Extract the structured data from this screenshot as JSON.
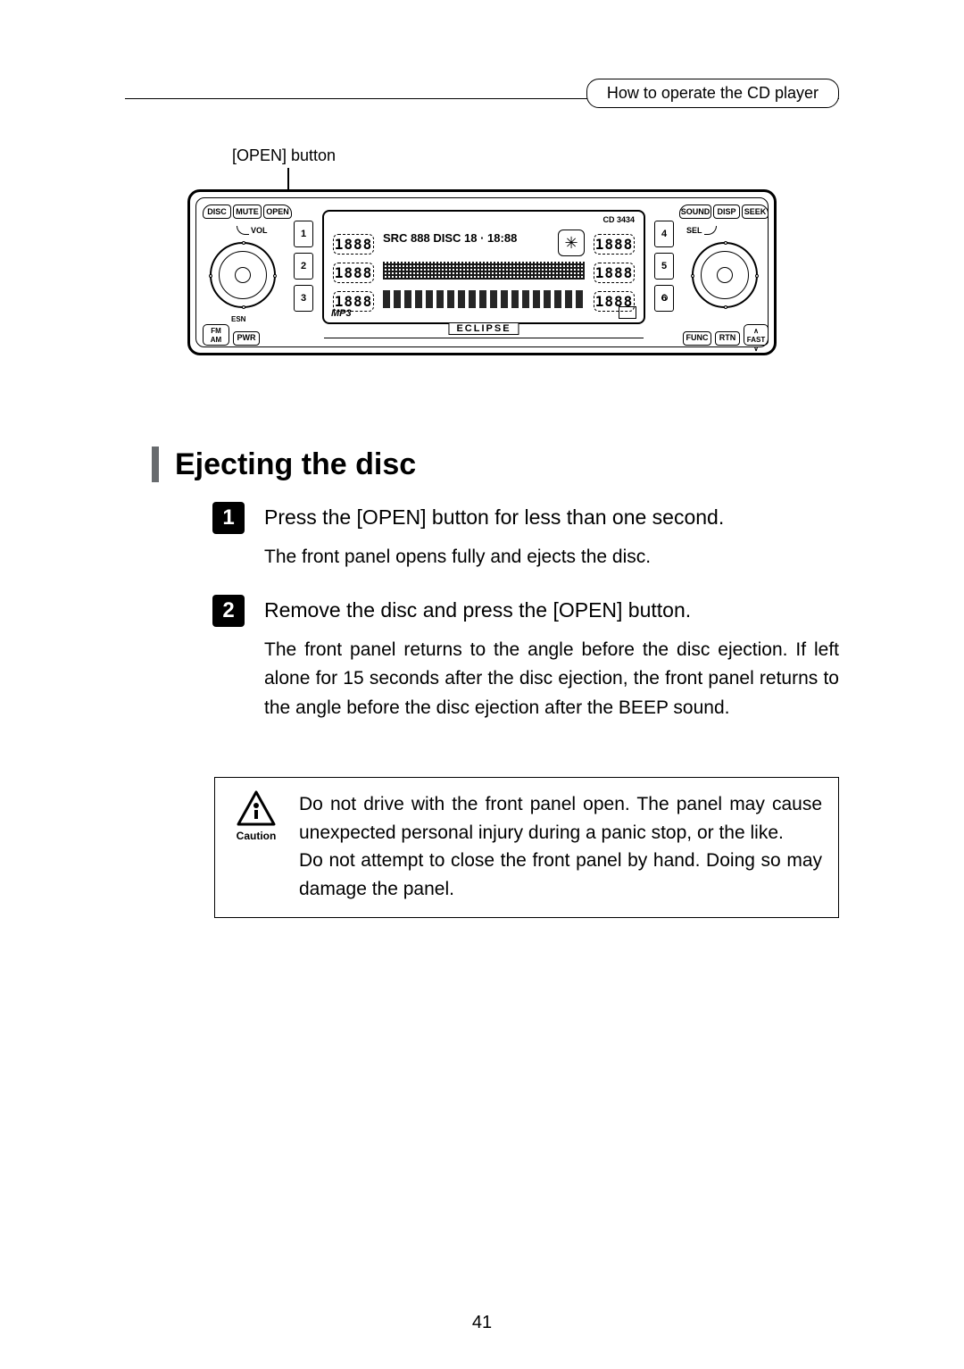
{
  "header": {
    "section_title": "How to operate the CD player"
  },
  "callout": {
    "label": "[OPEN] button"
  },
  "device": {
    "model": "CD 3434",
    "brand": "ECLIPSE",
    "mp3_label": "MP3",
    "buttons": {
      "disc": "DISC",
      "mute": "MUTE",
      "open": "OPEN",
      "vol": "VOL",
      "esn": "ESN",
      "fm": "FM",
      "am": "AM",
      "pwr": "PWR",
      "sound": "SOUND",
      "disp": "DISP",
      "seek": "SEEK",
      "sel": "SEL",
      "func": "FUNC",
      "rtn": "RTN",
      "fast": "FAST"
    },
    "presets_left": [
      "1",
      "2",
      "3"
    ],
    "presets_right": [
      "4",
      "5",
      "6"
    ],
    "lcd": {
      "row_seg": "1888",
      "top_labels": "SRC 888 DISC 18 · 18:88"
    }
  },
  "heading": "Ejecting the disc",
  "steps": [
    {
      "num": "1",
      "title": "Press the [OPEN] button for less than one second.",
      "desc": "The front panel opens fully and ejects the disc."
    },
    {
      "num": "2",
      "title": "Remove the disc and press the [OPEN] button.",
      "desc": "The front panel returns to the angle before the disc ejection.  If left alone for 15 seconds after the disc ejection, the front panel returns to the angle before the disc ejection after the BEEP sound."
    }
  ],
  "caution": {
    "label": "Caution",
    "text1": "Do not drive with the front panel open. The panel may cause unexpected personal injury during a panic stop, or the like.",
    "text2": "Do not attempt to close the front panel by hand. Doing so may damage the panel."
  },
  "page_number": "41"
}
